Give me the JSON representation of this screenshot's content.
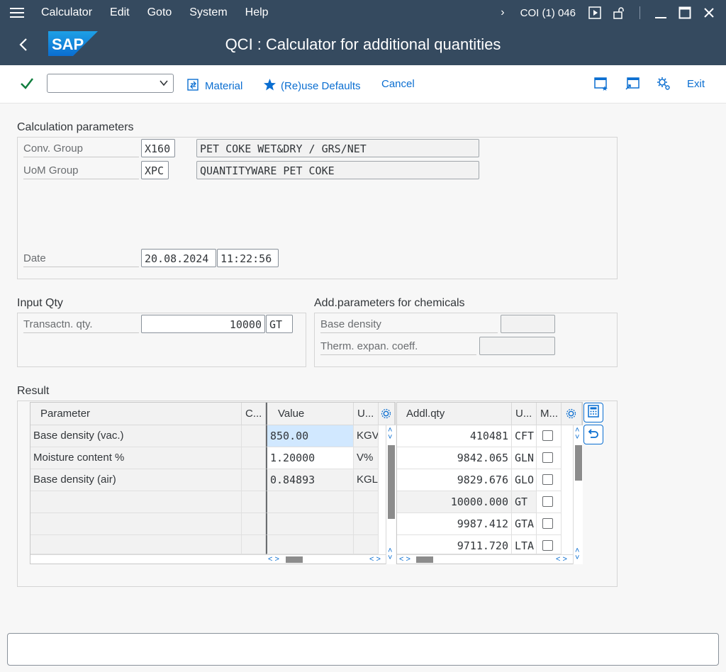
{
  "menu": {
    "items": [
      {
        "label": "Calculator"
      },
      {
        "label": "Edit"
      },
      {
        "label": "Goto"
      },
      {
        "label": "System"
      },
      {
        "label": "Help"
      }
    ],
    "session": "COI (1) 046"
  },
  "header": {
    "logo_text": "SAP",
    "title": "QCI : Calculator for additional quantities"
  },
  "toolbar": {
    "combo_value": "",
    "material": "Material",
    "reuse_defaults": "(Re)use Defaults",
    "cancel": "Cancel",
    "exit": "Exit"
  },
  "calc_params": {
    "title": "Calculation parameters",
    "conv_group_label": "Conv. Group",
    "conv_group_code": "X160",
    "conv_group_desc": "PET COKE WET&DRY / GRS/NET",
    "uom_group_label": "UoM Group",
    "uom_group_code": "XPC",
    "uom_group_desc": "QUANTITYWARE PET COKE",
    "date_label": "Date",
    "date": "20.08.2024",
    "time": "11:22:56"
  },
  "input_qty": {
    "title": "Input Qty",
    "label": "Transactn. qty.",
    "value": "10000",
    "unit": "GT"
  },
  "chem": {
    "title": "Add.parameters for chemicals",
    "base_density_label": "Base density",
    "base_density": "",
    "therm_label": "Therm. expan. coeff.",
    "therm": ""
  },
  "result": {
    "title": "Result",
    "left_headers": {
      "param": "Parameter",
      "c": "C...",
      "value": "Value",
      "u": "U..."
    },
    "left_rows": [
      {
        "param": "Base density (vac.)",
        "c": "",
        "value": "850.00",
        "unit": "KGV"
      },
      {
        "param": "Moisture content %",
        "c": "",
        "value": "1.20000",
        "unit": "V%"
      },
      {
        "param": "Base density (air)",
        "c": "",
        "value": "0.84893",
        "unit": "KGL"
      },
      {
        "param": "",
        "c": "",
        "value": "",
        "unit": ""
      },
      {
        "param": "",
        "c": "",
        "value": "",
        "unit": ""
      },
      {
        "param": "",
        "c": "",
        "value": "",
        "unit": ""
      }
    ],
    "right_headers": {
      "qty": "Addl.qty",
      "u": "U...",
      "m": "M..."
    },
    "right_rows": [
      {
        "qty": "410481",
        "unit": "CFT"
      },
      {
        "qty": "9842.065",
        "unit": "GLN"
      },
      {
        "qty": "9829.676",
        "unit": "GLO"
      },
      {
        "qty": "10000.000",
        "unit": "GT"
      },
      {
        "qty": "9987.412",
        "unit": "GTA"
      },
      {
        "qty": "9711.720",
        "unit": "LTA"
      }
    ]
  },
  "status": {
    "message": ""
  },
  "colors": {
    "shell": "#354a5f",
    "accent": "#0a6ed1",
    "success": "#107e3e"
  }
}
